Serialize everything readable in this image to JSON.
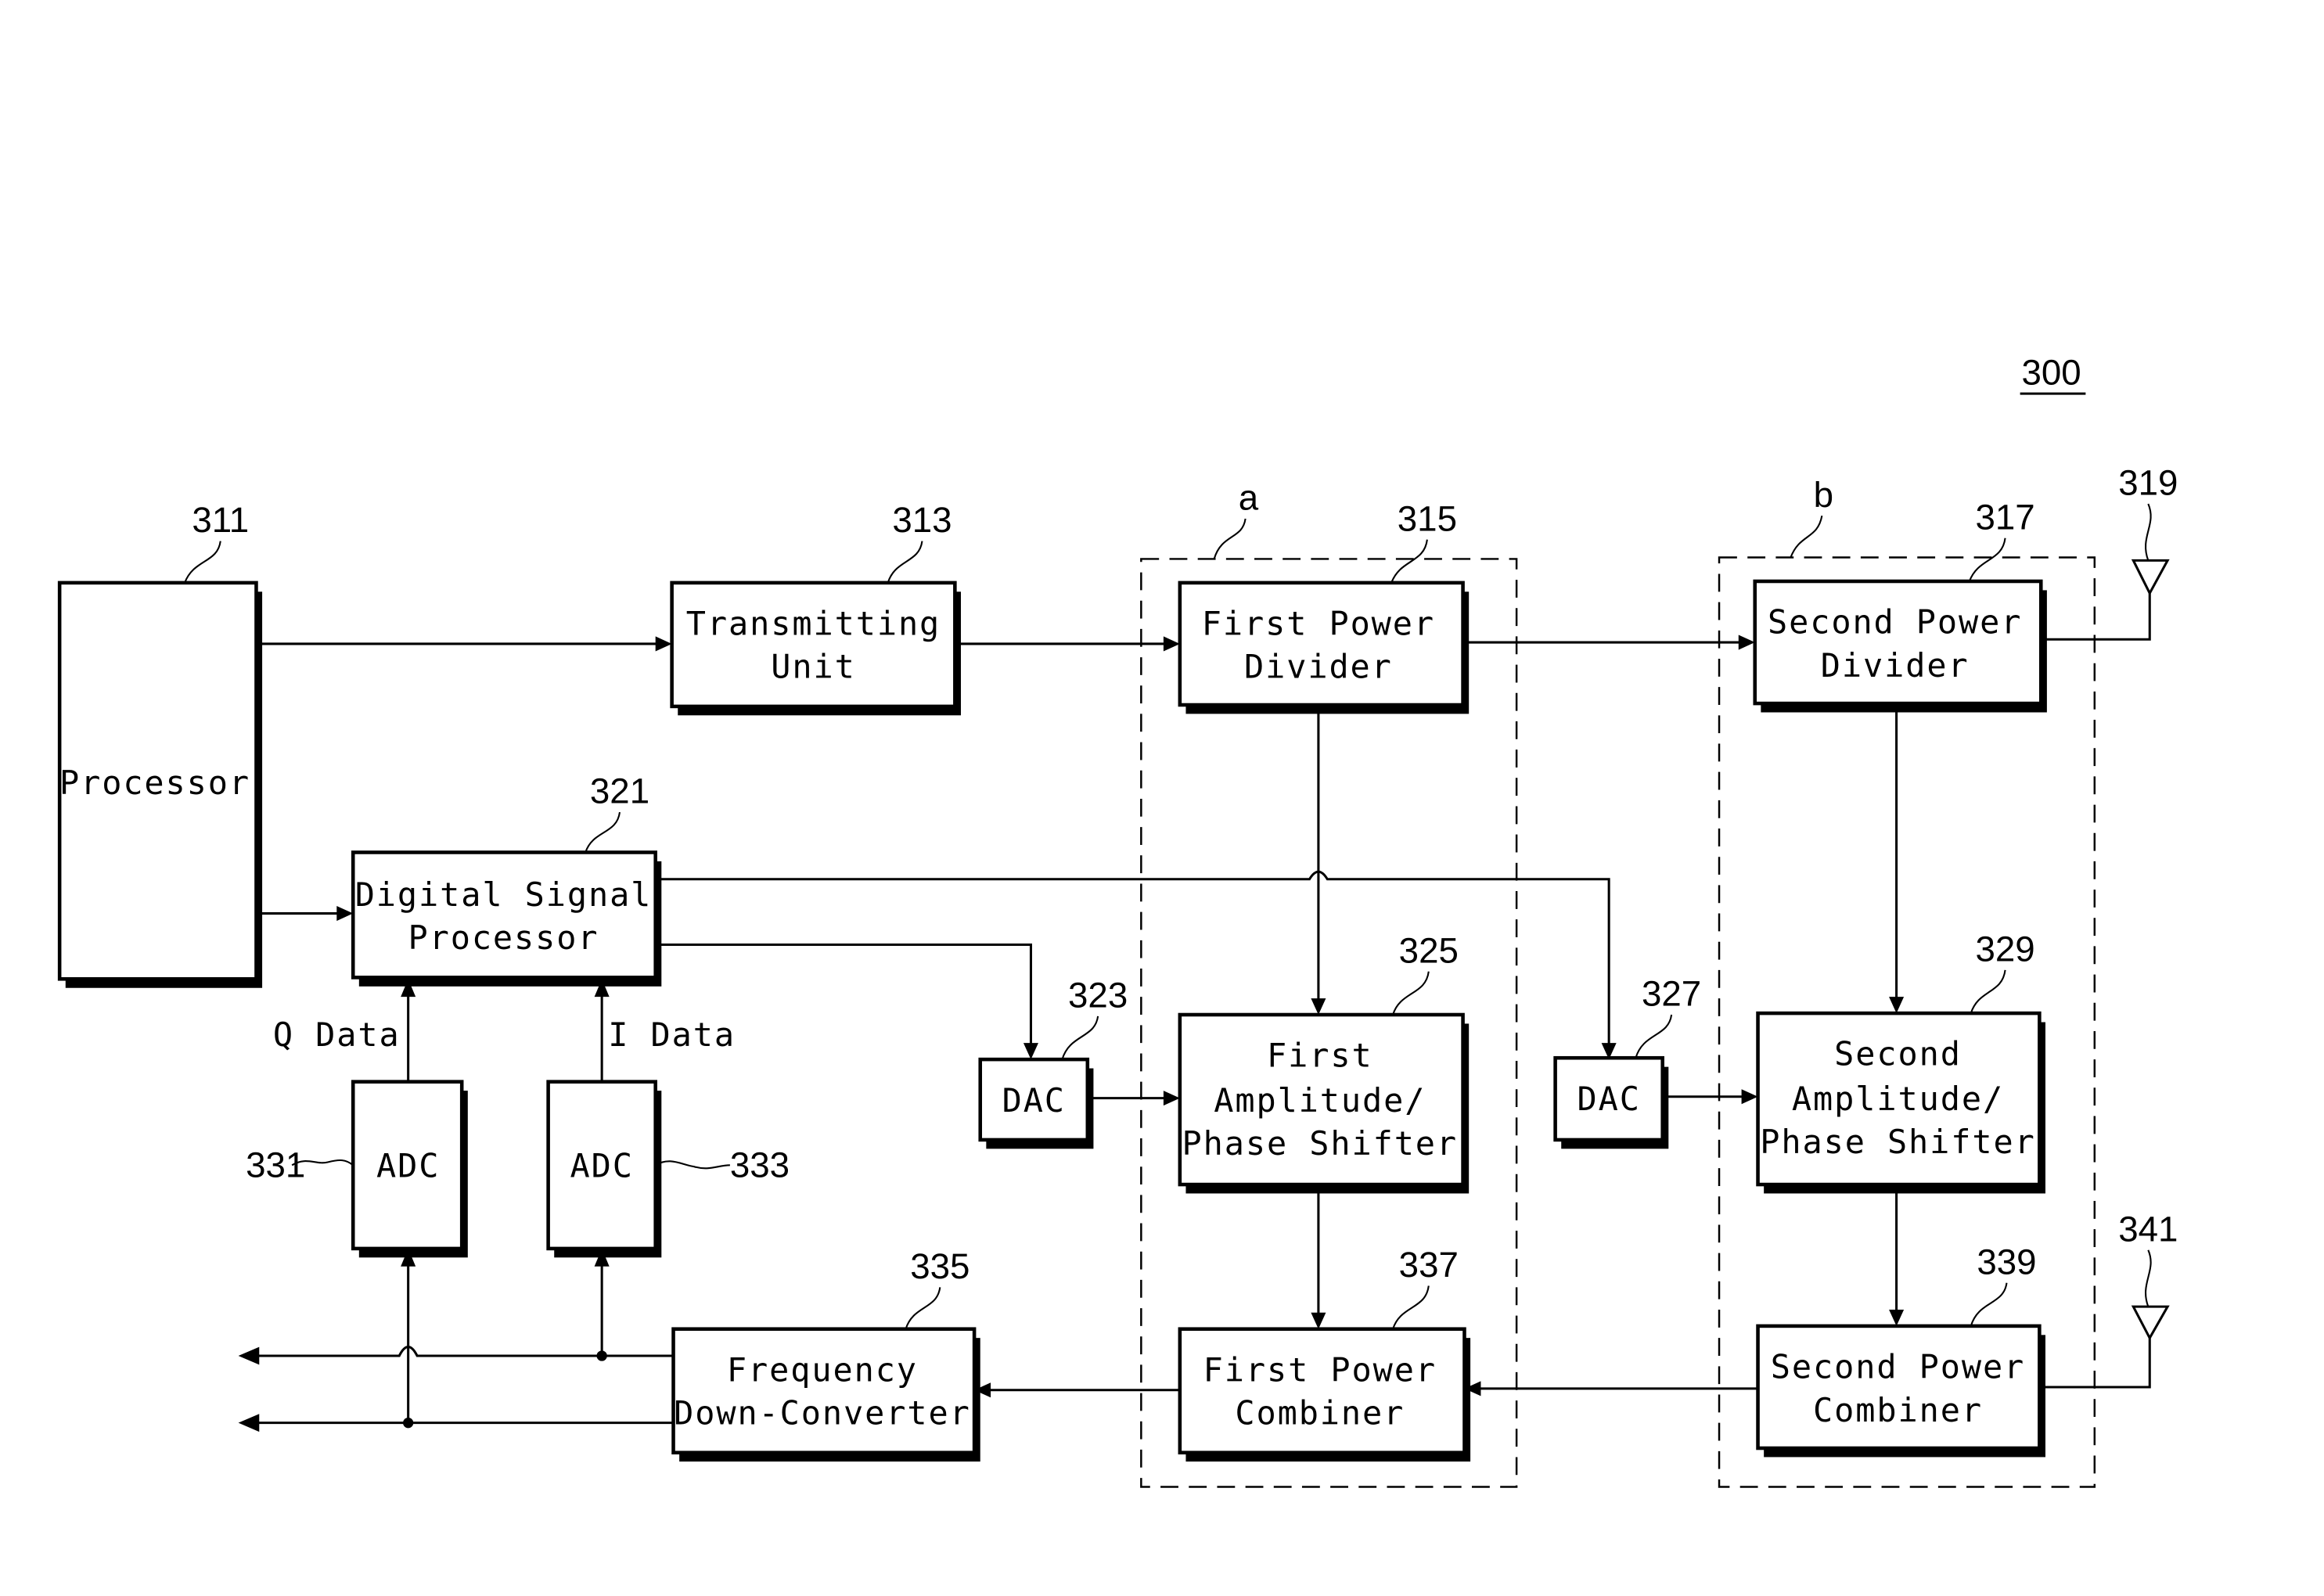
{
  "figure": {
    "number": "300",
    "group_labels": {
      "a": "a",
      "b": "b"
    }
  },
  "blocks": {
    "processor": {
      "ref": "311",
      "lines": [
        "Processor"
      ]
    },
    "transmitting_unit": {
      "ref": "313",
      "lines": [
        "Transmitting",
        "Unit"
      ]
    },
    "first_power_divider": {
      "ref": "315",
      "lines": [
        "First Power",
        "Divider"
      ]
    },
    "second_power_divider": {
      "ref": "317",
      "lines": [
        "Second Power",
        "Divider"
      ]
    },
    "tx_antenna": {
      "ref": "319"
    },
    "digital_signal_processor": {
      "ref": "321",
      "lines": [
        "Digital Signal",
        "Processor"
      ]
    },
    "dac_first": {
      "ref": "323",
      "lines": [
        "DAC"
      ]
    },
    "first_amp_phase_shifter": {
      "ref": "325",
      "lines": [
        "First",
        "Amplitude/",
        "Phase Shifter"
      ]
    },
    "dac_second": {
      "ref": "327",
      "lines": [
        "DAC"
      ]
    },
    "second_amp_phase_shifter": {
      "ref": "329",
      "lines": [
        "Second",
        "Amplitude/",
        "Phase Shifter"
      ]
    },
    "adc_q": {
      "ref": "331",
      "lines": [
        "ADC"
      ]
    },
    "adc_i": {
      "ref": "333",
      "lines": [
        "ADC"
      ]
    },
    "frequency_down_converter": {
      "ref": "335",
      "lines": [
        "Frequency",
        "Down-Converter"
      ]
    },
    "first_power_combiner": {
      "ref": "337",
      "lines": [
        "First Power",
        "Combiner"
      ]
    },
    "second_power_combiner": {
      "ref": "339",
      "lines": [
        "Second Power",
        "Combiner"
      ]
    },
    "rx_antenna": {
      "ref": "341"
    }
  },
  "signals": {
    "q_data": "Q Data",
    "i_data": "I Data"
  }
}
